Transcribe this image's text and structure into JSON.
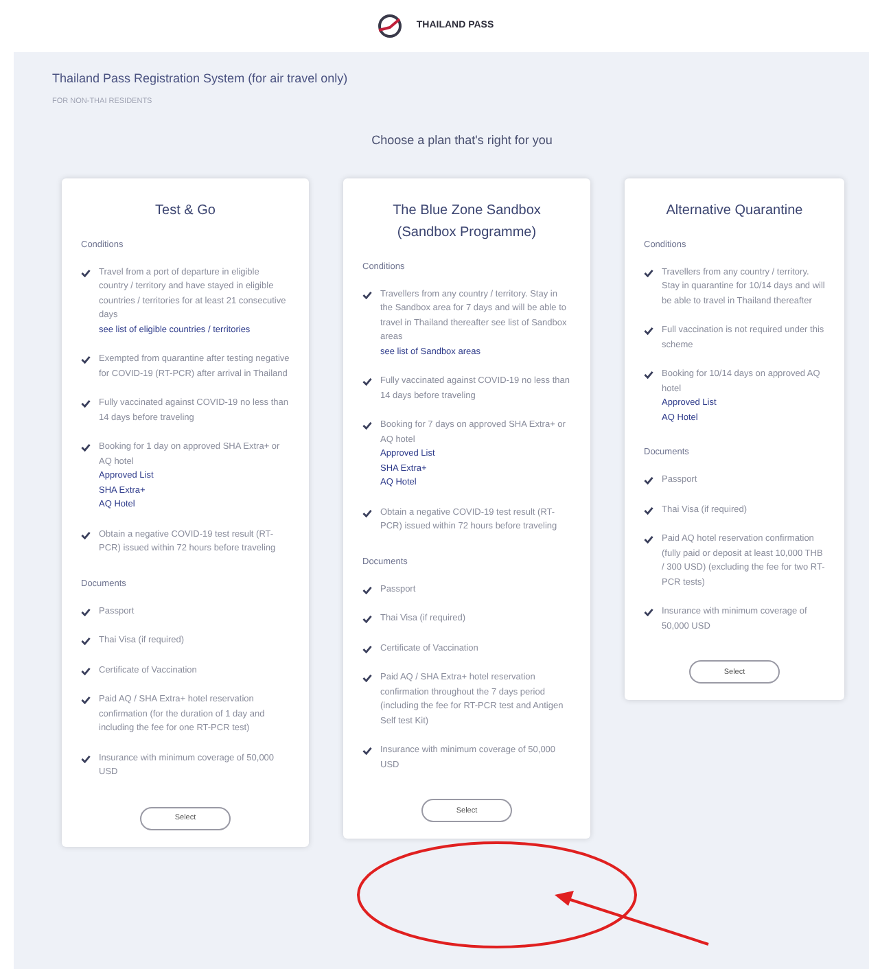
{
  "header": {
    "brand": "THAILAND PASS"
  },
  "page": {
    "title": "Thailand Pass Registration System (for air travel only)",
    "subtitle": "FOR NON-THAI RESIDENTS",
    "prompt": "Choose a plan that's right for you"
  },
  "plans": [
    {
      "title": "Test & Go",
      "sections": [
        {
          "heading": "Conditions",
          "items": [
            {
              "text": "Travel from a port of departure in eligible country / territory and have stayed in eligible countries / territories for at least 21 consecutive days",
              "links": [
                "see list of eligible countries / territories"
              ]
            },
            {
              "text": "Exempted from quarantine after testing negative for COVID-19 (RT-PCR) after arrival in Thailand"
            },
            {
              "text": "Fully vaccinated against COVID-19 no less than 14 days before traveling"
            },
            {
              "text": "Booking for 1 day on approved SHA Extra+ or AQ hotel",
              "links": [
                "Approved List",
                "SHA Extra+",
                "AQ Hotel"
              ]
            },
            {
              "text": "Obtain a negative COVID-19 test result (RT-PCR) issued within 72 hours before traveling"
            }
          ]
        },
        {
          "heading": "Documents",
          "items": [
            {
              "text": "Passport"
            },
            {
              "text": "Thai Visa (if required)"
            },
            {
              "text": "Certificate of Vaccination"
            },
            {
              "text": "Paid AQ / SHA Extra+ hotel reservation confirmation (for the duration of 1 day and including the fee for one RT-PCR test)"
            },
            {
              "text": "Insurance with minimum coverage of 50,000 USD"
            }
          ]
        }
      ],
      "button": "Select"
    },
    {
      "title": "The Blue Zone Sandbox (Sandbox Programme)",
      "sections": [
        {
          "heading": "Conditions",
          "items": [
            {
              "text": "Travellers from any country / territory. Stay in the Sandbox area for 7 days and will be able to travel in Thailand thereafter see list of Sandbox areas",
              "links": [
                "see list of Sandbox areas"
              ]
            },
            {
              "text": "Fully vaccinated against COVID-19 no less than 14 days before traveling"
            },
            {
              "text": "Booking for 7 days on approved SHA Extra+ or AQ hotel",
              "links": [
                "Approved List",
                "SHA Extra+",
                "AQ Hotel"
              ]
            },
            {
              "text": "Obtain a negative COVID-19 test result (RT-PCR) issued within 72 hours before traveling"
            }
          ]
        },
        {
          "heading": "Documents",
          "items": [
            {
              "text": "Passport"
            },
            {
              "text": "Thai Visa (if required)"
            },
            {
              "text": "Certificate of Vaccination"
            },
            {
              "text": "Paid AQ / SHA Extra+ hotel reservation confirmation throughout the 7 days period (including the fee for RT-PCR test and Antigen Self test Kit)"
            },
            {
              "text": "Insurance with minimum coverage of 50,000 USD"
            }
          ]
        }
      ],
      "button": "Select"
    },
    {
      "title": "Alternative Quarantine",
      "sections": [
        {
          "heading": "Conditions",
          "items": [
            {
              "text": "Travellers from any country / territory. Stay in quarantine for 10/14 days and will be able to travel in Thailand thereafter"
            },
            {
              "text": "Full vaccination is not required under this scheme"
            },
            {
              "text": "Booking for 10/14 days on approved AQ hotel",
              "links": [
                "Approved List",
                "AQ Hotel"
              ]
            }
          ]
        },
        {
          "heading": "Documents",
          "items": [
            {
              "text": "Passport"
            },
            {
              "text": "Thai Visa (if required)"
            },
            {
              "text": "Paid AQ hotel reservation confirmation (fully paid or deposit at least 10,000 THB / 300 USD) (excluding the fee for two RT-PCR tests)"
            },
            {
              "text": "Insurance with minimum coverage of 50,000 USD"
            }
          ]
        }
      ],
      "button": "Select"
    }
  ]
}
